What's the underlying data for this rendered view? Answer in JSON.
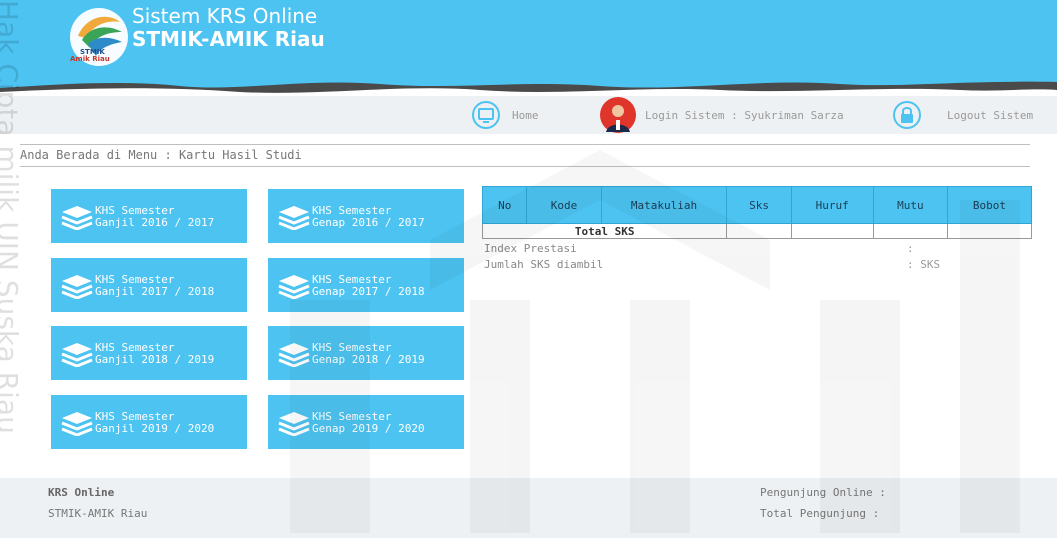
{
  "header": {
    "title": "Sistem KRS Online",
    "subtitle": "STMIK-AMIK Riau",
    "logo_line1": "STMIK",
    "logo_line2": "Amik Riau"
  },
  "nav": {
    "home_label": "Home",
    "login_label": "Login Sistem : Syukriman Sarza",
    "logout_label": "Logout Sistem"
  },
  "breadcrumb": "Anda Berada di Menu : Kartu Hasil Studi",
  "khs_buttons": [
    {
      "line1": "KHS Semester",
      "line2": "Ganjil 2016 / 2017"
    },
    {
      "line1": "KHS Semester",
      "line2": "Genap 2016 / 2017"
    },
    {
      "line1": "KHS Semester",
      "line2": "Ganjil 2017 / 2018"
    },
    {
      "line1": "KHS Semester",
      "line2": "Genap 2017 / 2018"
    },
    {
      "line1": "KHS Semester",
      "line2": "Ganjil 2018 / 2019"
    },
    {
      "line1": "KHS Semester",
      "line2": "Genap 2018 / 2019"
    },
    {
      "line1": "KHS Semester",
      "line2": "Ganjil 2019 / 2020"
    },
    {
      "line1": "KHS Semester",
      "line2": "Genap 2019 / 2020"
    }
  ],
  "table": {
    "headers": [
      "No",
      "Kode",
      "Matakuliah",
      "Sks",
      "Huruf",
      "Mutu",
      "Bobot"
    ],
    "total_label": "Total SKS"
  },
  "summary": {
    "ip_label": "Index Prestasi",
    "ip_value": ":",
    "sks_label": "Jumlah SKS diambil",
    "sks_value": ": SKS"
  },
  "footer": {
    "brand": "KRS Online",
    "org": "STMIK-AMIK Riau",
    "visitors_online": "Pengunjung Online :",
    "visitors_total": "Total Pengunjung :"
  },
  "watermark": {
    "side_text": "Hak Cipta milik UIN Suska Riau"
  },
  "colors": {
    "accent": "#4cc3f1",
    "navbar_bg": "#eef1f3",
    "text_grey": "#777777"
  }
}
